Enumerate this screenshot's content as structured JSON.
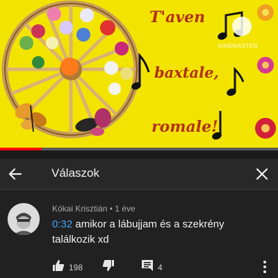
{
  "video": {
    "song_line_1": "T'aven",
    "song_line_2": "baxtale,",
    "song_line_3": "romale!",
    "watermark": "KINEMASTER",
    "progress_fraction": 0.15
  },
  "panel": {
    "title": "Válaszok",
    "back_icon": "arrow-left-icon",
    "close_icon": "close-icon"
  },
  "comment": {
    "author": "Kókai Krisztián",
    "separator": "•",
    "age": "1 éve",
    "timestamp": "0:32",
    "body": " amikor a lábujjam és a szekrény találkozik xd",
    "likes": "198",
    "replies": "4"
  },
  "colors": {
    "accent": "#ff0000",
    "link": "#3ea6ff",
    "background": "#212121"
  }
}
